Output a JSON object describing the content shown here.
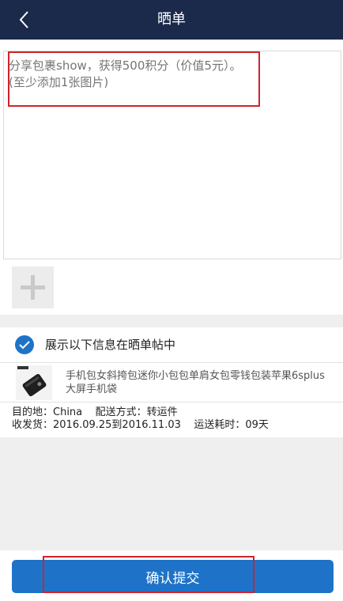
{
  "navbar": {
    "title": "晒单",
    "back_icon": "chevron-left-icon"
  },
  "editor": {
    "placeholder": "分享包裹show，获得500积分（价值5元）。\n(至少添加1张图片)"
  },
  "add_photo": {
    "icon": "plus-icon"
  },
  "show_info": {
    "checked": true,
    "label": "展示以下信息在晒单帖中"
  },
  "product": {
    "title": "手机包女斜挎包迷你小包包单肩女包零钱包装苹果6splus大屏手机袋"
  },
  "shipping": {
    "line1": "目的地：China    配送方式：转运件",
    "line2": "收发货：2016.09.25到2016.11.03    运送耗时：09天"
  },
  "submit": {
    "label": "确认提交"
  },
  "colors": {
    "navbar": "#1b2a4a",
    "primary": "#1e73c8",
    "highlight": "#d0232c"
  }
}
